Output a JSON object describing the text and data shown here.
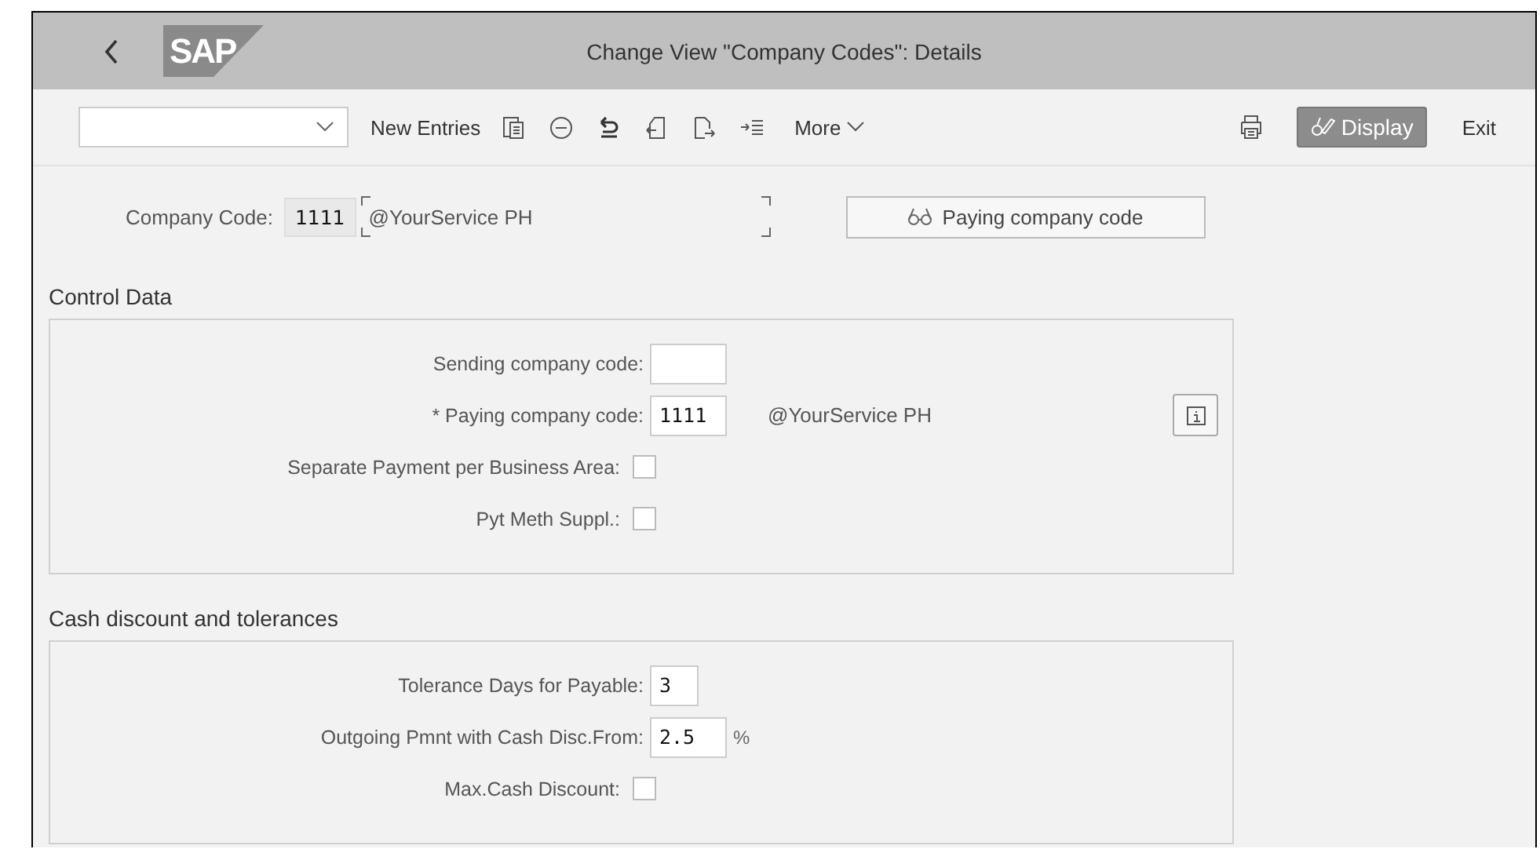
{
  "header": {
    "logo": "SAP",
    "title": "Change View \"Company Codes\": Details"
  },
  "toolbar": {
    "left": [
      "New Entries"
    ],
    "more": "More",
    "display": "Display",
    "exit": "Exit"
  },
  "company": {
    "label": "Company Code:",
    "code": "1111",
    "name": "@YourService PH",
    "button": "Paying company code"
  },
  "sections": [
    {
      "title": "Control Data",
      "rows": [
        {
          "kind": "input",
          "label": "Sending company code:",
          "value": ""
        },
        {
          "kind": "input",
          "label": "* Paying company code:",
          "value": "1111",
          "description": "@YourService PH",
          "info": true
        },
        {
          "kind": "checkbox",
          "label": "Separate Payment per Business Area:",
          "checked": false
        },
        {
          "kind": "checkbox",
          "label": "Pyt Meth Suppl.:",
          "checked": false
        }
      ]
    },
    {
      "title": "Cash discount and tolerances",
      "rows": [
        {
          "kind": "input",
          "label": "Tolerance Days for Payable:",
          "value": "3"
        },
        {
          "kind": "input",
          "label": "Outgoing Pmnt with Cash Disc.From:",
          "value": "2.5",
          "unit": "%"
        },
        {
          "kind": "checkbox",
          "label": "Max.Cash Discount:",
          "checked": false
        }
      ]
    }
  ]
}
